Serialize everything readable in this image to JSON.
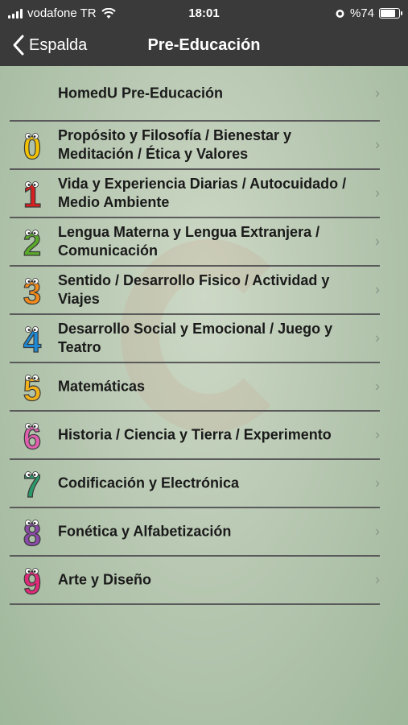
{
  "status_bar": {
    "carrier": "vodafone TR",
    "time": "18:01",
    "battery": "%74",
    "battery_level": 0.74
  },
  "nav": {
    "back_label": "Espalda",
    "title": "Pre-Educación"
  },
  "header_item": {
    "label": "HomedU Pre-Educación"
  },
  "items": [
    {
      "digit": "0",
      "color": "#f2c300",
      "label": "Propósito y Filosofía / Bienestar y Meditación / Ética y Valores"
    },
    {
      "digit": "1",
      "color": "#d62020",
      "label": "Vida y Experiencia Diarias / Autocuidado / Medio Ambiente"
    },
    {
      "digit": "2",
      "color": "#5aa82a",
      "label": "Lengua Materna y Lengua Extranjera / Comunicación"
    },
    {
      "digit": "3",
      "color": "#f08a1c",
      "label": "Sentido / Desarrollo Fisico / Actividad y Viajes"
    },
    {
      "digit": "4",
      "color": "#1c8ad6",
      "label": "Desarrollo Social y Emocional / Juego y Teatro"
    },
    {
      "digit": "5",
      "color": "#f2b21c",
      "label": "Matemáticas"
    },
    {
      "digit": "6",
      "color": "#e060b0",
      "label": "Historia / Ciencia y Tierra / Experimento"
    },
    {
      "digit": "7",
      "color": "#2a9a6a",
      "label": "Codificación y Electrónica"
    },
    {
      "digit": "8",
      "color": "#8a4aa8",
      "label": "Fonética y Alfabetización"
    },
    {
      "digit": "9",
      "color": "#e02a7a",
      "label": "Arte y Diseño"
    }
  ],
  "icons": {
    "chevron": "chevron-right-icon",
    "back": "chevron-left-icon",
    "wifi": "wifi-icon",
    "alarm": "alarm-icon",
    "battery": "battery-icon",
    "signal": "signal-icon"
  }
}
